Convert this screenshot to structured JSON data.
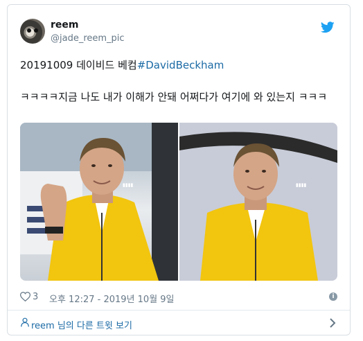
{
  "user": {
    "display_name": "reem",
    "handle": "@jade_reem_pic"
  },
  "tweet": {
    "line1_prefix": "20191009 데이비드 베컴",
    "hashtag": "#DavidBeckham",
    "line2": "ㅋㅋㅋㅋ지금 나도 내가 이해가 안돼 어쩌다가 여기에 와 있는지 ㅋㅋㅋ"
  },
  "media": {
    "photos": [
      {
        "watermark": "▮▮▮▮"
      },
      {
        "watermark": "▮▮▮▮"
      }
    ]
  },
  "meta": {
    "like_count": "3",
    "timestamp": "오후 12:27 - 2019년 10월 9일",
    "info_symbol": "i"
  },
  "footer": {
    "more_tweets": "reem 님의 다른 트윗 보기"
  },
  "colors": {
    "twitter_blue": "#1da1f2",
    "link_blue": "#1b6aa5",
    "jacket_yellow": "#f2c50f"
  }
}
